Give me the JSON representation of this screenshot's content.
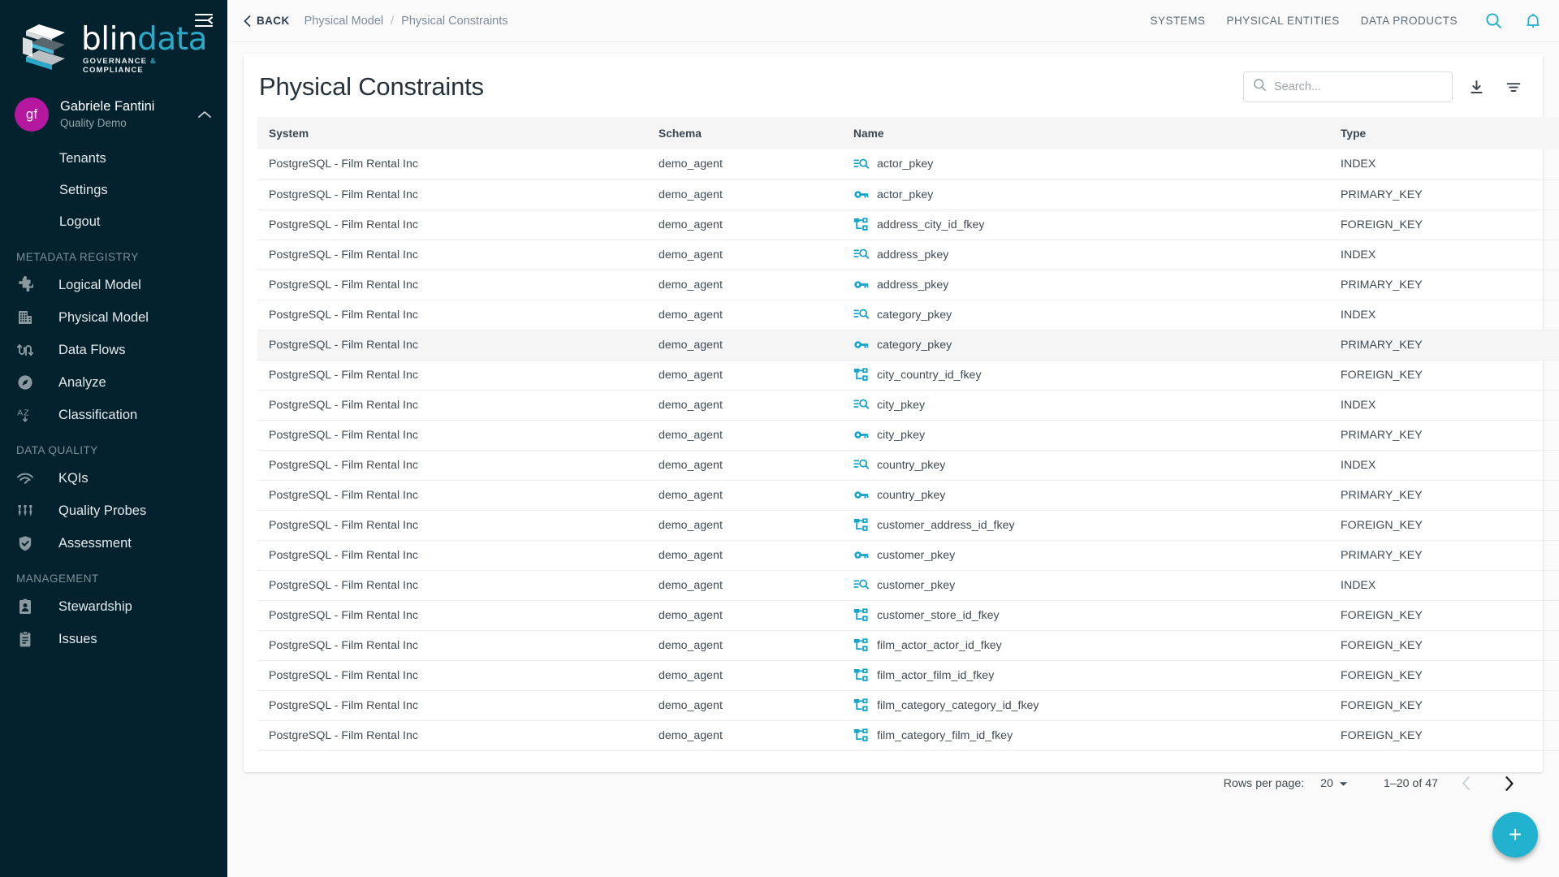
{
  "sidebar": {
    "collapse_icon": "collapse-menu-icon",
    "brand": {
      "word1": "blin",
      "word2": "data",
      "tagline_left": "GOVERNANCE",
      "tagline_amp": "&",
      "tagline_right": "COMPLIANCE"
    },
    "user": {
      "initials": "gf",
      "name": "Gabriele Fantini",
      "tenant": "Quality Demo",
      "chevron": "chevron-up-icon"
    },
    "user_links": [
      {
        "label": "Tenants",
        "name": "tenants"
      },
      {
        "label": "Settings",
        "name": "settings"
      },
      {
        "label": "Logout",
        "name": "logout"
      }
    ],
    "sections": [
      {
        "title": "METADATA REGISTRY",
        "items": [
          {
            "label": "Logical Model",
            "icon": "puzzle-piece-icon",
            "name": "logical-model"
          },
          {
            "label": "Physical Model",
            "icon": "building-icon",
            "name": "physical-model"
          },
          {
            "label": "Data Flows",
            "icon": "data-flows-icon",
            "name": "data-flows"
          },
          {
            "label": "Analyze",
            "icon": "compass-icon",
            "name": "analyze"
          },
          {
            "label": "Classification",
            "icon": "sort-alpha-icon",
            "name": "classification"
          }
        ]
      },
      {
        "title": "DATA QUALITY",
        "items": [
          {
            "label": "KQIs",
            "icon": "speedometer-icon",
            "name": "kqis"
          },
          {
            "label": "Quality Probes",
            "icon": "sliders-icon",
            "name": "quality-probes"
          },
          {
            "label": "Assessment",
            "icon": "shield-check-icon",
            "name": "assessment"
          }
        ]
      },
      {
        "title": "MANAGEMENT",
        "items": [
          {
            "label": "Stewardship",
            "icon": "id-badge-icon",
            "name": "stewardship"
          },
          {
            "label": "Issues",
            "icon": "clipboard-icon",
            "name": "issues"
          }
        ]
      }
    ]
  },
  "topbar": {
    "back_label": "BACK",
    "breadcrumb": {
      "parent": "Physical Model",
      "separator": "/",
      "current": "Physical Constraints"
    },
    "nav": [
      {
        "label": "SYSTEMS",
        "name": "systems"
      },
      {
        "label": "PHYSICAL ENTITIES",
        "name": "physical-entities"
      },
      {
        "label": "DATA PRODUCTS",
        "name": "data-products"
      }
    ],
    "icons": [
      {
        "icon": "search-icon",
        "name": "global-search"
      },
      {
        "icon": "bell-icon",
        "name": "notifications"
      }
    ]
  },
  "page": {
    "title": "Physical Constraints",
    "search": {
      "placeholder": "Search...",
      "value": ""
    },
    "download_icon": "download-icon",
    "filter_icon": "filter-icon",
    "fab_label": "+",
    "accent_color": "#20b2cf",
    "sidebar_color": "#04222e",
    "avatar_color": "#b5179e"
  },
  "table": {
    "columns": [
      {
        "key": "system",
        "label": "System"
      },
      {
        "key": "schema",
        "label": "Schema"
      },
      {
        "key": "name",
        "label": "Name"
      },
      {
        "key": "type",
        "label": "Type"
      }
    ],
    "rows": [
      {
        "system": "PostgreSQL - Film Rental Inc",
        "schema": "demo_agent",
        "name": "actor_pkey",
        "type": "INDEX",
        "icon": "index-icon",
        "highlighted": false
      },
      {
        "system": "PostgreSQL - Film Rental Inc",
        "schema": "demo_agent",
        "name": "actor_pkey",
        "type": "PRIMARY_KEY",
        "icon": "key-icon",
        "highlighted": false
      },
      {
        "system": "PostgreSQL - Film Rental Inc",
        "schema": "demo_agent",
        "name": "address_city_id_fkey",
        "type": "FOREIGN_KEY",
        "icon": "foreign-key-icon",
        "highlighted": false
      },
      {
        "system": "PostgreSQL - Film Rental Inc",
        "schema": "demo_agent",
        "name": "address_pkey",
        "type": "INDEX",
        "icon": "index-icon",
        "highlighted": false
      },
      {
        "system": "PostgreSQL - Film Rental Inc",
        "schema": "demo_agent",
        "name": "address_pkey",
        "type": "PRIMARY_KEY",
        "icon": "key-icon",
        "highlighted": false
      },
      {
        "system": "PostgreSQL - Film Rental Inc",
        "schema": "demo_agent",
        "name": "category_pkey",
        "type": "INDEX",
        "icon": "index-icon",
        "highlighted": false
      },
      {
        "system": "PostgreSQL - Film Rental Inc",
        "schema": "demo_agent",
        "name": "category_pkey",
        "type": "PRIMARY_KEY",
        "icon": "key-icon",
        "highlighted": true
      },
      {
        "system": "PostgreSQL - Film Rental Inc",
        "schema": "demo_agent",
        "name": "city_country_id_fkey",
        "type": "FOREIGN_KEY",
        "icon": "foreign-key-icon",
        "highlighted": false
      },
      {
        "system": "PostgreSQL - Film Rental Inc",
        "schema": "demo_agent",
        "name": "city_pkey",
        "type": "INDEX",
        "icon": "index-icon",
        "highlighted": false
      },
      {
        "system": "PostgreSQL - Film Rental Inc",
        "schema": "demo_agent",
        "name": "city_pkey",
        "type": "PRIMARY_KEY",
        "icon": "key-icon",
        "highlighted": false
      },
      {
        "system": "PostgreSQL - Film Rental Inc",
        "schema": "demo_agent",
        "name": "country_pkey",
        "type": "INDEX",
        "icon": "index-icon",
        "highlighted": false
      },
      {
        "system": "PostgreSQL - Film Rental Inc",
        "schema": "demo_agent",
        "name": "country_pkey",
        "type": "PRIMARY_KEY",
        "icon": "key-icon",
        "highlighted": false
      },
      {
        "system": "PostgreSQL - Film Rental Inc",
        "schema": "demo_agent",
        "name": "customer_address_id_fkey",
        "type": "FOREIGN_KEY",
        "icon": "foreign-key-icon",
        "highlighted": false
      },
      {
        "system": "PostgreSQL - Film Rental Inc",
        "schema": "demo_agent",
        "name": "customer_pkey",
        "type": "PRIMARY_KEY",
        "icon": "key-icon",
        "highlighted": false
      },
      {
        "system": "PostgreSQL - Film Rental Inc",
        "schema": "demo_agent",
        "name": "customer_pkey",
        "type": "INDEX",
        "icon": "index-icon",
        "highlighted": false
      },
      {
        "system": "PostgreSQL - Film Rental Inc",
        "schema": "demo_agent",
        "name": "customer_store_id_fkey",
        "type": "FOREIGN_KEY",
        "icon": "foreign-key-icon",
        "highlighted": false
      },
      {
        "system": "PostgreSQL - Film Rental Inc",
        "schema": "demo_agent",
        "name": "film_actor_actor_id_fkey",
        "type": "FOREIGN_KEY",
        "icon": "foreign-key-icon",
        "highlighted": false
      },
      {
        "system": "PostgreSQL - Film Rental Inc",
        "schema": "demo_agent",
        "name": "film_actor_film_id_fkey",
        "type": "FOREIGN_KEY",
        "icon": "foreign-key-icon",
        "highlighted": false
      },
      {
        "system": "PostgreSQL - Film Rental Inc",
        "schema": "demo_agent",
        "name": "film_category_category_id_fkey",
        "type": "FOREIGN_KEY",
        "icon": "foreign-key-icon",
        "highlighted": false
      },
      {
        "system": "PostgreSQL - Film Rental Inc",
        "schema": "demo_agent",
        "name": "film_category_film_id_fkey",
        "type": "FOREIGN_KEY",
        "icon": "foreign-key-icon",
        "highlighted": false
      }
    ]
  },
  "pagination": {
    "rows_per_page_label": "Rows per page:",
    "rows_per_page_value": "20",
    "range_label": "1–20 of 47",
    "prev_icon": "chevron-left-icon",
    "next_icon": "chevron-right-icon"
  }
}
